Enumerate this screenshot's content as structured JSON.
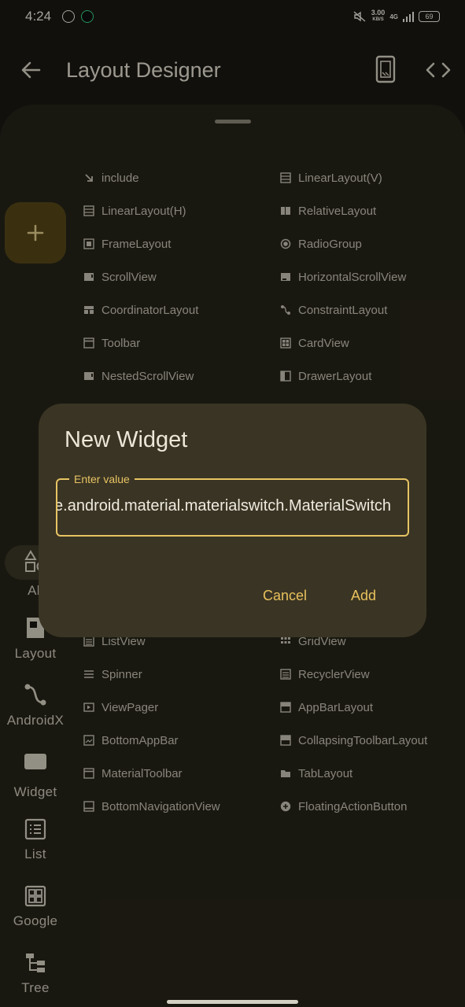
{
  "status_bar": {
    "time": "4:24",
    "speed_value": "3.00",
    "speed_unit": "KB/S",
    "network": "4G",
    "battery": "69"
  },
  "app_bar": {
    "title": "Layout Designer",
    "back_icon": "arrow-back-icon",
    "device_icon": "smartphone-icon",
    "code_icon": "code-icon"
  },
  "fab": {
    "icon": "plus-icon"
  },
  "rail": {
    "items": [
      {
        "label": "All",
        "icon": "shapes-icon"
      },
      {
        "label": "Layout",
        "icon": "layout-icon"
      },
      {
        "label": "AndroidX",
        "icon": "androidx-icon"
      },
      {
        "label": "Widget",
        "icon": "widget-icon"
      },
      {
        "label": "List",
        "icon": "list-icon"
      },
      {
        "label": "Google",
        "icon": "google-icon"
      },
      {
        "label": "Tree",
        "icon": "tree-icon"
      }
    ]
  },
  "widgets": {
    "col1": [
      "include",
      "LinearLayout(H)",
      "FrameLayout",
      "ScrollView",
      "CoordinatorLayout",
      "Toolbar",
      "NestedScrollView",
      "ListView",
      "Spinner",
      "ViewPager",
      "BottomAppBar",
      "MaterialToolbar",
      "BottomNavigationView"
    ],
    "col2": [
      "LinearLayout(V)",
      "RelativeLayout",
      "RadioGroup",
      "HorizontalScrollView",
      "ConstraintLayout",
      "CardView",
      "DrawerLayout",
      "GridView",
      "RecyclerView",
      "AppBarLayout",
      "CollapsingToolbarLayout",
      "TabLayout",
      "FloatingActionButton"
    ]
  },
  "dialog": {
    "title": "New Widget",
    "field_label": "Enter value",
    "field_value": "com.google.android.material.materialswitch.MaterialSwitch",
    "cancel_label": "Cancel",
    "add_label": "Add"
  },
  "colors": {
    "background": "#1a1912",
    "sheet": "#262419",
    "dialog": "#3a3424",
    "accent": "#e7c463",
    "fab": "#564818"
  }
}
